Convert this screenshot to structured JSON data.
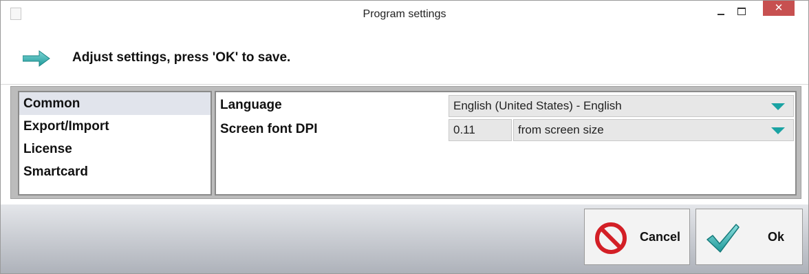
{
  "window": {
    "title": "Program settings",
    "close_glyph": "✕"
  },
  "header": {
    "instruction": "Adjust settings, press 'OK' to save.",
    "icon": "arrow-right-icon"
  },
  "categories": [
    {
      "label": "Common",
      "selected": true
    },
    {
      "label": "Export/Import",
      "selected": false
    },
    {
      "label": "License",
      "selected": false
    },
    {
      "label": "Smartcard",
      "selected": false
    }
  ],
  "settings": {
    "language_label": "Language",
    "language_value": "English (United States) - English",
    "dpi_label": "Screen font DPI",
    "dpi_value": "0.11",
    "dpi_mode": "from screen size"
  },
  "buttons": {
    "cancel_label": "Cancel",
    "ok_label": "Ok"
  },
  "colors": {
    "accent_teal": "#1aa3a3",
    "close_red": "#c75050",
    "cancel_red": "#d31f26"
  }
}
